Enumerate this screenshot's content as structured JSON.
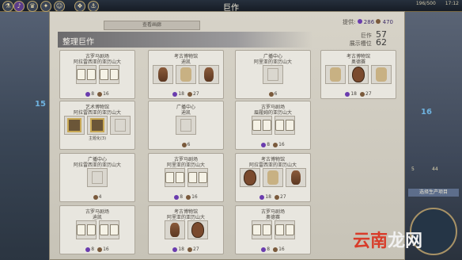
{
  "top": {
    "title": "巨作",
    "right_line1": "196/500",
    "right_line2": "1358年",
    "time": "17:12",
    "icons": [
      "science-icon",
      "culture-icon",
      "government-icon",
      "religion-icon",
      "great-people-icon",
      "great-works-icon",
      "trade-icon"
    ]
  },
  "map": {
    "tile_left": "15",
    "tile_right": "16",
    "right_labels": [
      "5",
      "44"
    ],
    "production_label": "选择生产项目"
  },
  "panel": {
    "view_tab": "查看画廊",
    "title": "整理巨作",
    "supply_label": "提供:",
    "supply_a": "286",
    "supply_b": "470",
    "stat_works_label": "巨作",
    "stat_works_value": "57",
    "stat_slots_label": "展示槽位",
    "stat_slots_value": "62"
  },
  "cards": [
    {
      "name": "古罗马剧场",
      "sub": "阿拉雷西亚的亚历山大",
      "slots": [
        "book",
        "book"
      ],
      "yield_a": "8",
      "yield_b": "16"
    },
    {
      "name": "考古博物馆",
      "sub": "迪凯",
      "slots": [
        "vase",
        "relic",
        "vase"
      ],
      "yield_a": "18",
      "yield_b": "27"
    },
    {
      "name": "广播中心",
      "sub": "阿里亚的亚历山大",
      "slots": [
        "empty"
      ],
      "yield_a": "",
      "yield_b": "6"
    },
    {
      "name": "考古博物馆",
      "sub": "奥德赛",
      "slots": [
        "relic",
        "shield",
        "relic"
      ],
      "yield_a": "18",
      "yield_b": "27"
    },
    {
      "name": "艺术博物馆",
      "sub": "阿拉雷西亚的亚历山大",
      "slots": [
        "painting",
        "painting",
        "empty"
      ],
      "yield_a": "",
      "yield_b": "",
      "theme": "主题化(3)"
    },
    {
      "name": "广播中心",
      "sub": "迪凯",
      "slots": [
        "empty"
      ],
      "yield_a": "",
      "yield_b": "6"
    },
    {
      "name": "古罗马剧场",
      "sub": "眉履姆的亚历山大",
      "slots": [
        "book",
        "book"
      ],
      "yield_a": "8",
      "yield_b": "16"
    },
    {
      "name": "",
      "sub": "",
      "slots": [],
      "yield_a": "",
      "yield_b": ""
    },
    {
      "name": "广播中心",
      "sub": "阿拉雷西亚的亚历山大",
      "slots": [
        "empty"
      ],
      "yield_a": "",
      "yield_b": "4"
    },
    {
      "name": "古罗马剧场",
      "sub": "阿里亚的亚历山大",
      "slots": [
        "book",
        "book"
      ],
      "yield_a": "8",
      "yield_b": "16"
    },
    {
      "name": "考古博物馆",
      "sub": "阿拉雷西亚的亚历山大",
      "slots": [
        "shield",
        "relic",
        "vase"
      ],
      "yield_a": "18",
      "yield_b": "27"
    },
    {
      "name": "",
      "sub": "",
      "slots": [],
      "yield_a": "",
      "yield_b": ""
    },
    {
      "name": "古罗马剧场",
      "sub": "迪凯",
      "slots": [
        "book",
        "book"
      ],
      "yield_a": "8",
      "yield_b": "16"
    },
    {
      "name": "考古博物馆",
      "sub": "阿里亚的亚历山大",
      "slots": [
        "vase",
        "shield"
      ],
      "yield_a": "18",
      "yield_b": "27"
    },
    {
      "name": "古罗马剧场",
      "sub": "奥德赛",
      "slots": [
        "book",
        "book"
      ],
      "yield_a": "8",
      "yield_b": "16"
    },
    {
      "name": "",
      "sub": "",
      "slots": [],
      "yield_a": "",
      "yield_b": ""
    }
  ],
  "watermark": {
    "red": "云南",
    "rest": "龙网"
  }
}
